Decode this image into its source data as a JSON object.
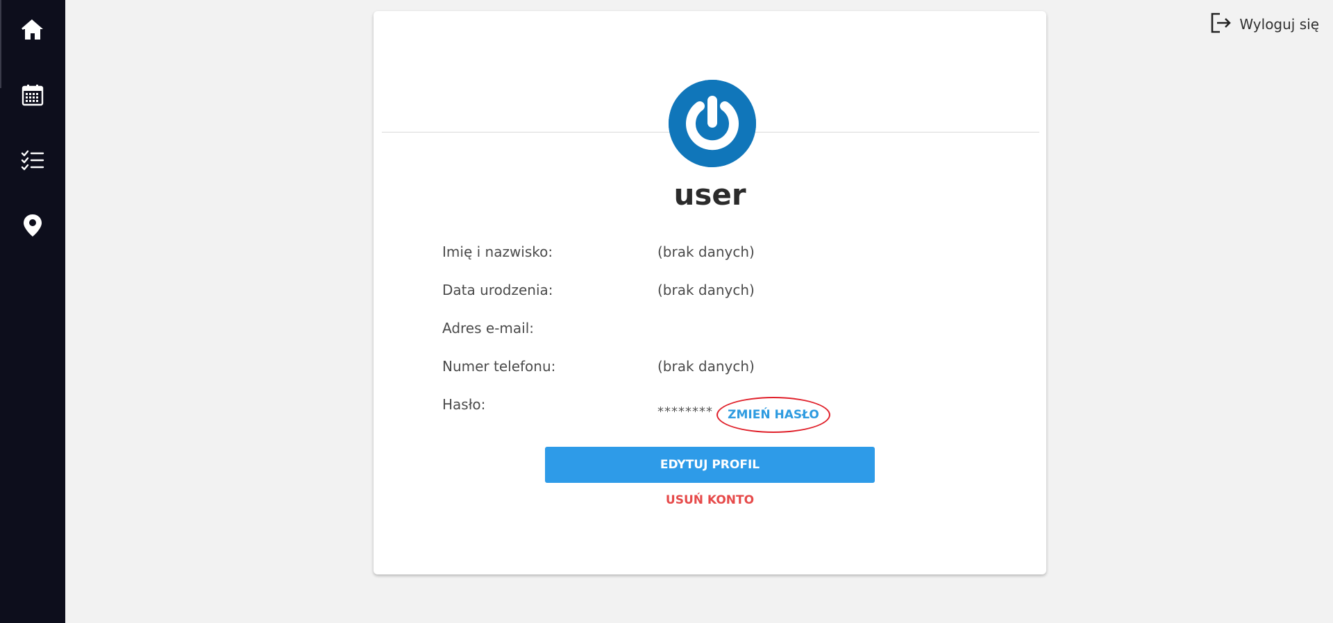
{
  "sidebar": {
    "items": [
      {
        "name": "home",
        "icon": "home-icon"
      },
      {
        "name": "calendar",
        "icon": "calendar-icon"
      },
      {
        "name": "tasks",
        "icon": "checklist-icon"
      },
      {
        "name": "map",
        "icon": "map-pin-icon"
      }
    ]
  },
  "header": {
    "logout_label": "Wyloguj się",
    "logout_icon": "logout-icon"
  },
  "profile": {
    "avatar_icon": "power-icon",
    "username": "user",
    "fields": [
      {
        "label": "Imię i nazwisko:",
        "value": "(brak danych)"
      },
      {
        "label": "Data urodzenia:",
        "value": "(brak danych)"
      },
      {
        "label": "Adres e-mail:",
        "value": ""
      },
      {
        "label": "Numer telefonu:",
        "value": "(brak danych)"
      },
      {
        "label": "Hasło:",
        "value": "********"
      }
    ],
    "change_password_label": "ZMIEŃ HASŁO",
    "edit_profile_label": "EDYTUJ PROFIL",
    "delete_account_label": "USUŃ KONTO"
  },
  "colors": {
    "sidebar_bg": "#0d0e1c",
    "accent": "#2e9be8",
    "danger": "#e64a4a",
    "avatar_bg": "#1076ba",
    "highlight_ring": "#e0202a"
  }
}
